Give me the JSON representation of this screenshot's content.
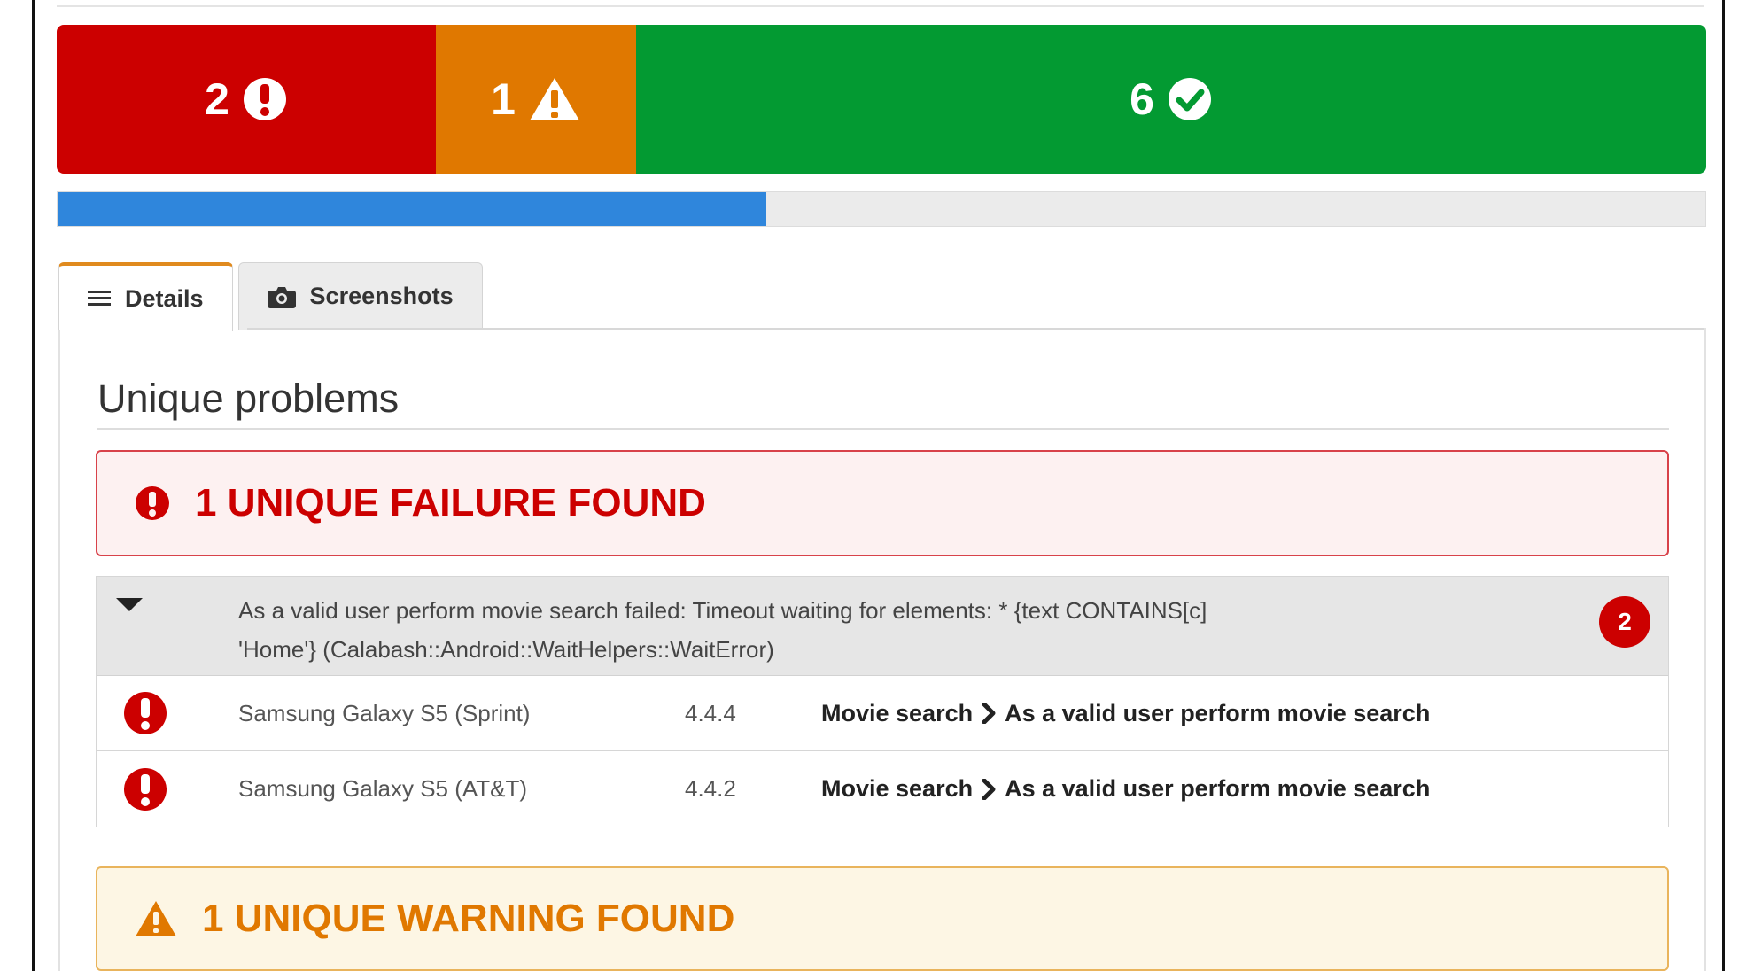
{
  "summary": {
    "failures": "2",
    "warnings": "1",
    "passed": "6",
    "colors": {
      "fail": "#cc0000",
      "warn": "#e07800",
      "pass": "#039a32",
      "progress": "#2f86dc"
    },
    "icons": {
      "fail": "exclamation-circle-icon",
      "warn": "warning-triangle-icon",
      "pass": "check-circle-icon"
    }
  },
  "progress": {
    "fraction": 0.43
  },
  "tabs": [
    {
      "label": "Details",
      "icon": "list-icon",
      "active": true
    },
    {
      "label": "Screenshots",
      "icon": "camera-icon",
      "active": false
    }
  ],
  "unique_problems": {
    "title": "Unique problems",
    "failure_alert": "1 UNIQUE FAILURE FOUND",
    "warning_alert": "1 UNIQUE WARNING FOUND",
    "failure_group": {
      "message_line1": "As a valid user perform movie search failed: Timeout waiting for elements: * {text CONTAINS[c]",
      "message_line2": "'Home'} (Calabash::Android::WaitHelpers::WaitError)",
      "count": "2",
      "rows": [
        {
          "device": "Samsung Galaxy S5 (Sprint)",
          "os": "4.4.4",
          "feature": "Movie search",
          "scenario": "As a valid user perform movie search"
        },
        {
          "device": "Samsung Galaxy S5 (AT&T)",
          "os": "4.4.2",
          "feature": "Movie search",
          "scenario": "As a valid user perform movie search"
        }
      ]
    }
  }
}
